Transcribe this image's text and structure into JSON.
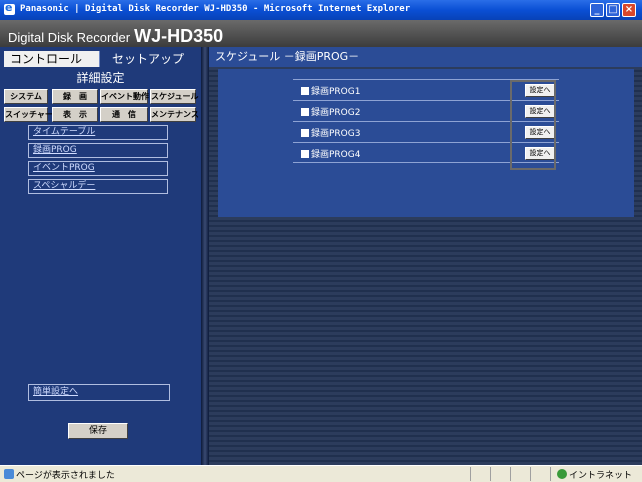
{
  "window": {
    "title": "Panasonic | Digital Disk Recorder WJ-HD350 - Microsoft Internet Explorer"
  },
  "header": {
    "brand": "Digital Disk Recorder",
    "model": "WJ-HD350"
  },
  "tabs": {
    "control": "コントロール",
    "setup": "セットアップ"
  },
  "sidebar": {
    "title": "詳細設定",
    "categories": [
      "システム",
      "録　画",
      "イベント動作",
      "スケジュール",
      "スイッチャー",
      "表　示",
      "通　信",
      "メンテナンス"
    ],
    "menu": [
      "タイムテーブル",
      "録画PROG",
      "イベントPROG",
      "スペシャルデー"
    ],
    "easy_setup": "簡単設定へ",
    "save": "保存"
  },
  "main": {
    "heading": "スケジュール －録画PROG－",
    "programs": [
      {
        "label": "録画PROG1",
        "button": "設定へ"
      },
      {
        "label": "録画PROG2",
        "button": "設定へ"
      },
      {
        "label": "録画PROG3",
        "button": "設定へ"
      },
      {
        "label": "録画PROG4",
        "button": "設定へ"
      }
    ]
  },
  "statusbar": {
    "text": "ページが表示されました",
    "zone": "イントラネット"
  }
}
